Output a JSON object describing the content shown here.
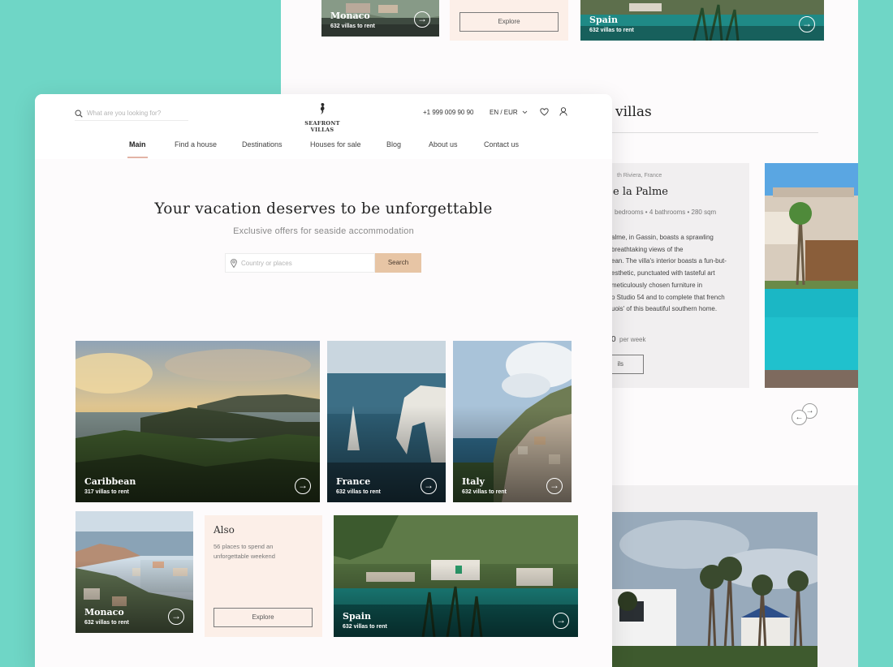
{
  "back_page": {
    "top_cards": [
      {
        "title": "Monaco",
        "subtitle": "632 villas to rent"
      },
      {
        "title": "Spain",
        "subtitle": "632 villas to rent"
      }
    ],
    "explore_label": "Explore",
    "section_heading": "villas",
    "featured": {
      "location": "th Riviera, France",
      "name": "e la Palme",
      "meta": "bedrooms • 4 bathrooms • 280 sqm",
      "description_lines": [
        "alme, in Gassin, boasts a sprawling",
        "breathtaking views of the",
        "ean. The villa's interior boasts a fun-but-",
        "esthetic, punctuated with tasteful art",
        "meticulously chosen furniture in",
        "o Studio 54 and to complete that french",
        "uois' of this beautiful southern home."
      ],
      "price": "0",
      "price_unit": "per week",
      "details_label": "ils"
    },
    "nav_prev": "←",
    "nav_next": "→"
  },
  "header": {
    "search_placeholder": "What are you looking for?",
    "logo_text": "SEAFRONT VILLAS",
    "phone": "+1 999 009 90 90",
    "language_currency": "EN / EUR"
  },
  "nav": {
    "items": [
      "Main",
      "Find a house",
      "Destinations",
      "Houses for sale",
      "Blog",
      "About us",
      "Contact us"
    ],
    "active_index": 0
  },
  "hero": {
    "title": "Your vacation deserves to be unforgettable",
    "subtitle": "Exclusive offers for seaside accommodation",
    "search_placeholder": "Country or places",
    "search_button": "Search"
  },
  "destinations": [
    {
      "title": "Caribbean",
      "subtitle": "317 villas to rent"
    },
    {
      "title": "France",
      "subtitle": "632 villas to rent"
    },
    {
      "title": "Italy",
      "subtitle": "632 villas to rent"
    },
    {
      "title": "Monaco",
      "subtitle": "632 villas to rent"
    },
    {
      "title": "Spain",
      "subtitle": "632 villas to rent"
    }
  ],
  "also": {
    "title": "Also",
    "subtitle": "56 places to spend an unforgettable weekend",
    "button": "Explore"
  },
  "colors": {
    "background": "#6fd6c6",
    "accent": "#e7c5a5",
    "peach": "#fcefe8",
    "underline": "#e3b4a6"
  },
  "icons": {
    "arrow": "→",
    "arrow_back": "←",
    "search": "search-icon",
    "pin": "map-pin-icon",
    "heart": "heart-icon",
    "user": "user-icon",
    "chevron": "chevron-down-icon"
  }
}
